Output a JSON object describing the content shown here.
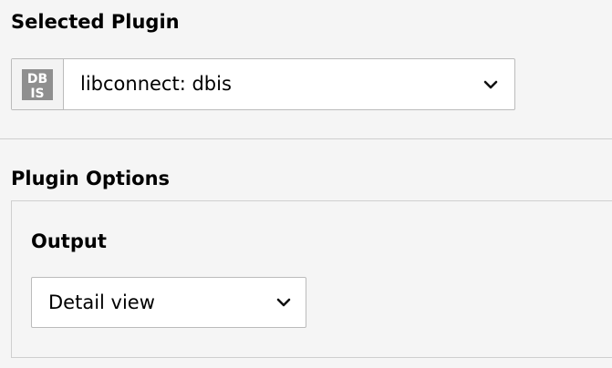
{
  "selected_plugin": {
    "title": "Selected Plugin",
    "value": "libconnect: dbis",
    "icon": "dbis-plugin-icon",
    "icon_text_line1": "DB",
    "icon_text_line2": "IS"
  },
  "plugin_options": {
    "title": "Plugin Options",
    "output": {
      "label": "Output",
      "value": "Detail view"
    }
  },
  "colors": {
    "background": "#f5f5f5",
    "field_background": "#ffffff",
    "border": "#bbbbbb",
    "icon_background": "#8f8f8f"
  }
}
